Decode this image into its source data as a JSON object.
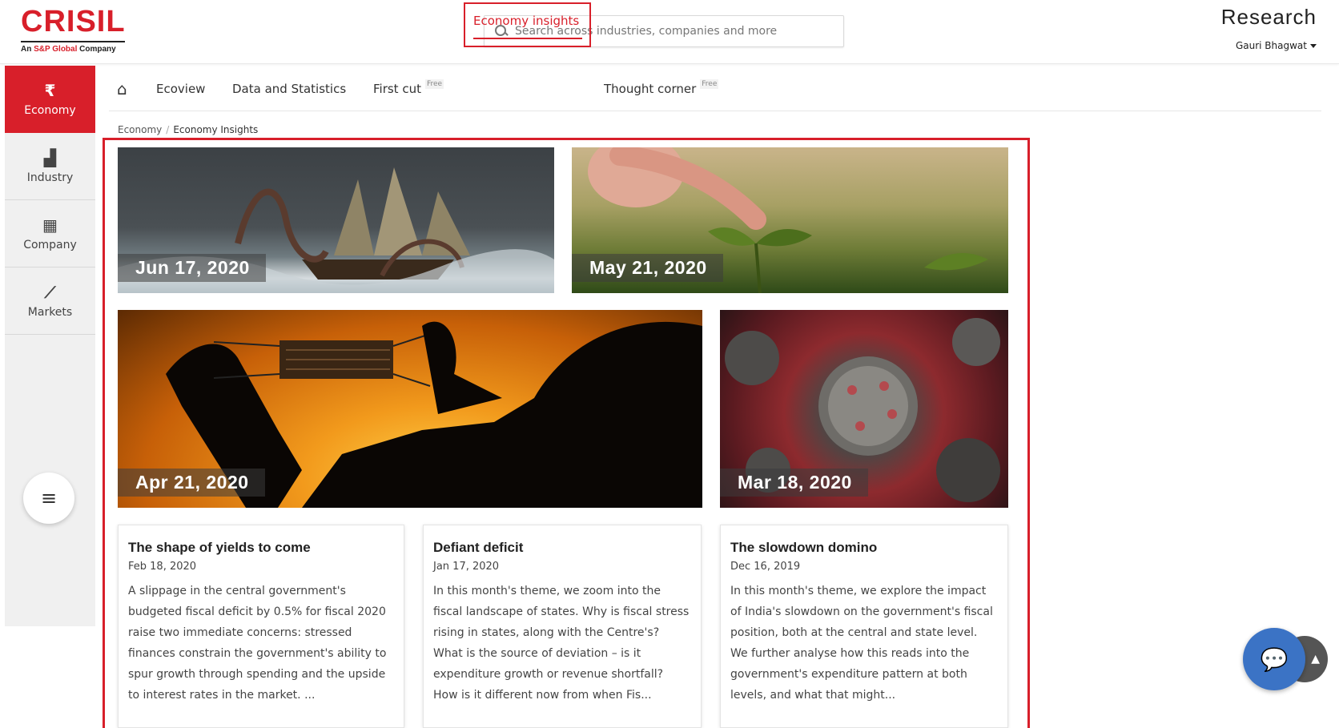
{
  "header": {
    "logo_main": "CRISIL",
    "logo_sub_prefix": "An ",
    "logo_sub_brand": "S&P Global",
    "logo_sub_suffix": " Company",
    "search_placeholder": "Search across industries, companies and more",
    "product": "Research",
    "user_name": "Gauri Bhagwat"
  },
  "sidebar": {
    "items": [
      {
        "icon": "₹",
        "label": "Economy"
      },
      {
        "icon": "▟",
        "label": "Industry"
      },
      {
        "icon": "▦",
        "label": "Company"
      },
      {
        "icon": "⟋",
        "label": "Markets"
      }
    ],
    "menu_icon": "≡"
  },
  "nav": {
    "home_icon": "⌂",
    "items": [
      "Ecoview",
      "Data and Statistics",
      "First cut",
      "Economy insights",
      "Thought corner"
    ],
    "free_badge": "Free"
  },
  "breadcrumb": {
    "root": "Economy",
    "separator": "/",
    "current": "Economy Insights"
  },
  "tiles": [
    {
      "date": "Jun 17, 2020"
    },
    {
      "date": "May 21, 2020"
    },
    {
      "date": "Apr 21, 2020"
    },
    {
      "date": "Mar 18, 2020"
    }
  ],
  "cards": [
    {
      "title": "The shape of yields to come",
      "date": "Feb 18, 2020",
      "text": "A slippage in the central government's budgeted fiscal deficit by 0.5% for fiscal 2020 raise two immediate concerns: stressed finances constrain the government's ability to spur growth through spending and the upside to interest rates in the market. ..."
    },
    {
      "title": "Defiant deficit",
      "date": "Jan 17, 2020",
      "text": "In this month's theme, we zoom into the fiscal landscape of states. Why is fiscal stress rising in states, along with the Centre's? What is the source of deviation – is it expenditure growth or revenue shortfall? How is it different now from when Fis..."
    },
    {
      "title": "The slowdown domino",
      "date": "Dec 16, 2019",
      "text": "In this month's theme, we explore the impact of India's slowdown on the government's fiscal position, both at the central and state level. We further analyse how this reads into the government's expenditure pattern at both levels, and what that might..."
    }
  ],
  "colors": {
    "brand_red": "#d81f2a",
    "sidebar_bg": "#f0f0f0",
    "chat_blue": "#3b73c5"
  },
  "floating": {
    "chat_icon": "💬",
    "top_icon": "▲"
  }
}
